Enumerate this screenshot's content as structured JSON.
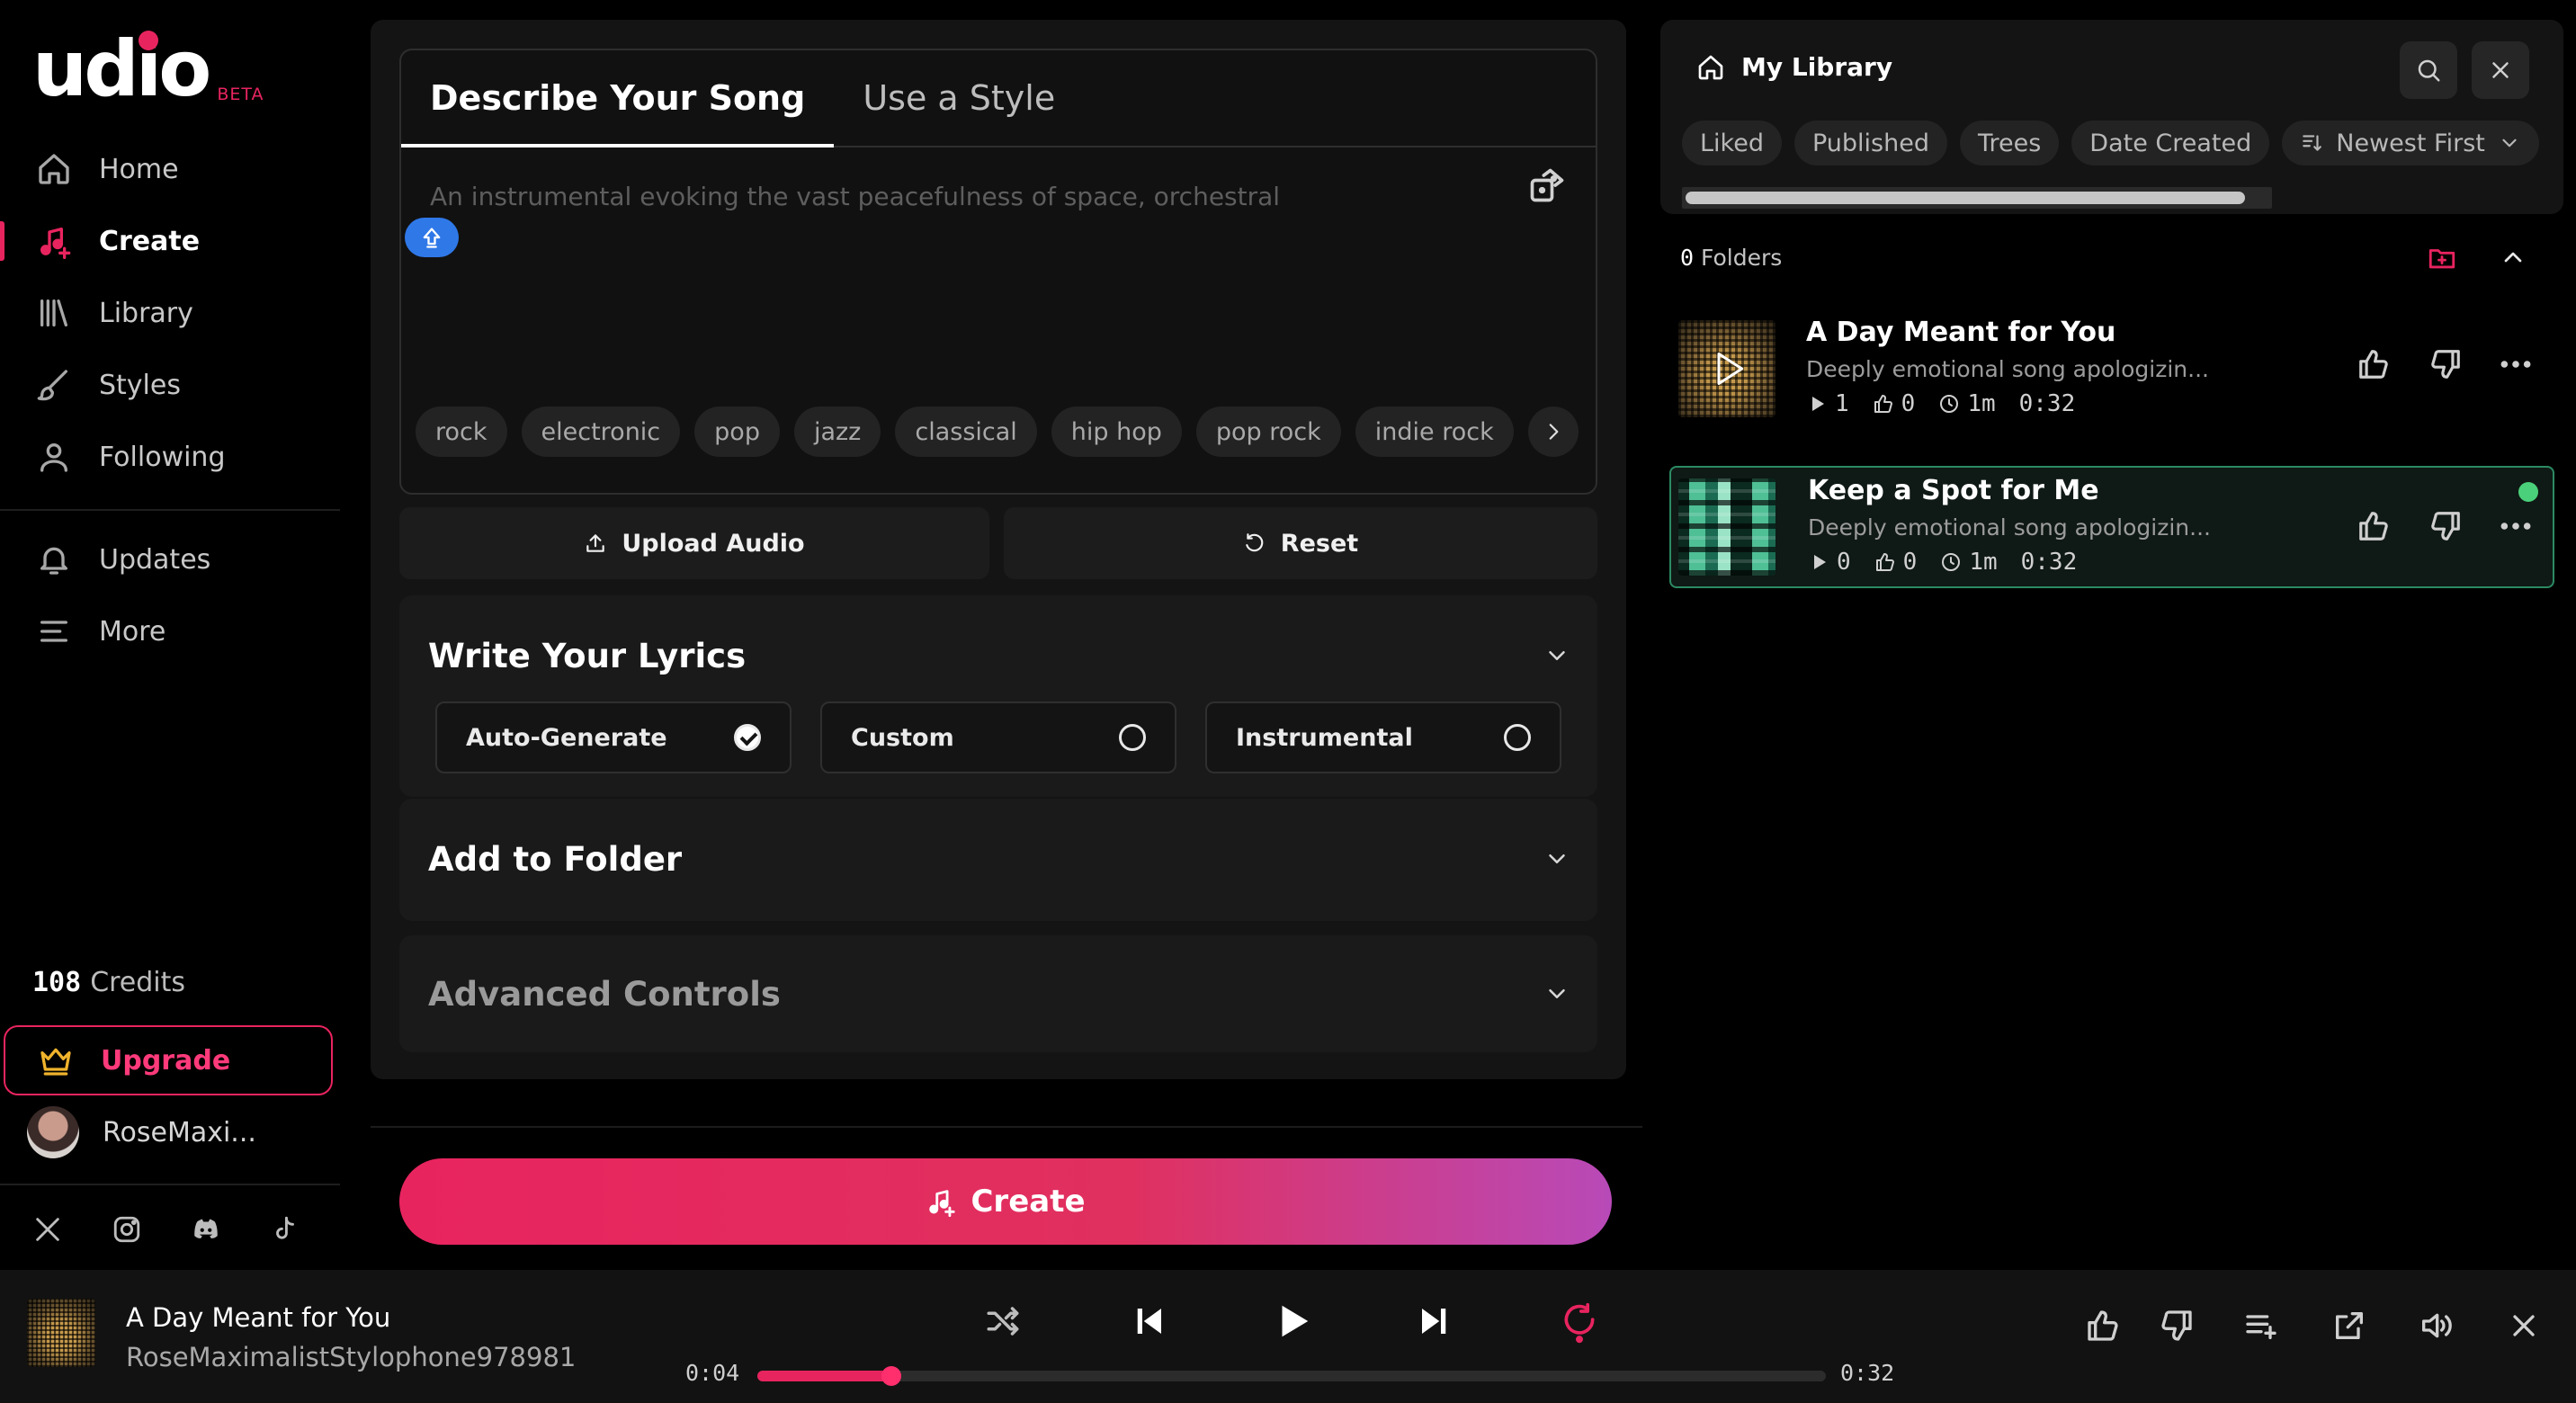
{
  "brand": {
    "name": "udio",
    "badge": "BETA",
    "accent": "#e8245f"
  },
  "nav": {
    "primary": [
      {
        "label": "Home",
        "icon": "home-icon",
        "active": false
      },
      {
        "label": "Create",
        "icon": "music-note-plus-icon",
        "active": true
      },
      {
        "label": "Library",
        "icon": "library-icon",
        "active": false
      },
      {
        "label": "Styles",
        "icon": "brush-icon",
        "active": false
      },
      {
        "label": "Following",
        "icon": "user-icon",
        "active": false
      }
    ],
    "secondary": [
      {
        "label": "Updates",
        "icon": "bell-icon"
      },
      {
        "label": "More",
        "icon": "menu-lines-icon"
      }
    ]
  },
  "account": {
    "credits_value": "108",
    "credits_label": "Credits",
    "upgrade_label": "Upgrade",
    "username": "RoseMaxi..."
  },
  "socials": [
    "x-icon",
    "instagram-icon",
    "discord-icon",
    "tiktok-icon"
  ],
  "create_form": {
    "tabs": [
      "Describe Your Song",
      "Use a Style"
    ],
    "active_tab": 0,
    "prompt_placeholder": "An instrumental evoking the vast peacefulness of space, orchestral",
    "genre_chips": [
      "rock",
      "electronic",
      "pop",
      "jazz",
      "classical",
      "hip hop",
      "pop rock",
      "indie rock"
    ],
    "upload_label": "Upload Audio",
    "reset_label": "Reset",
    "lyrics": {
      "title": "Write Your Lyrics",
      "options": [
        {
          "label": "Auto-Generate",
          "selected": true
        },
        {
          "label": "Custom",
          "selected": false
        },
        {
          "label": "Instrumental",
          "selected": false
        }
      ]
    },
    "folder_title": "Add to Folder",
    "advanced_title": "Advanced Controls",
    "create_label": "Create"
  },
  "library": {
    "title": "My Library",
    "filters": [
      "Liked",
      "Published",
      "Trees",
      "Date Created"
    ],
    "sort_label": "Newest First",
    "folders_count": "0",
    "folders_label": "Folders",
    "tracks": [
      {
        "title": "A Day Meant for You",
        "description": "Deeply emotional song apologizin...",
        "plays": "1",
        "likes": "0",
        "age": "1m",
        "duration": "0:32",
        "active": false
      },
      {
        "title": "Keep a Spot for Me",
        "description": "Deeply emotional song apologizin...",
        "plays": "0",
        "likes": "0",
        "age": "1m",
        "duration": "0:32",
        "active": true
      }
    ]
  },
  "player": {
    "title": "A Day Meant for You",
    "artist": "RoseMaximalistStylophone978981",
    "current_time": "0:04",
    "total_time": "0:32",
    "progress_fraction": 0.125
  }
}
